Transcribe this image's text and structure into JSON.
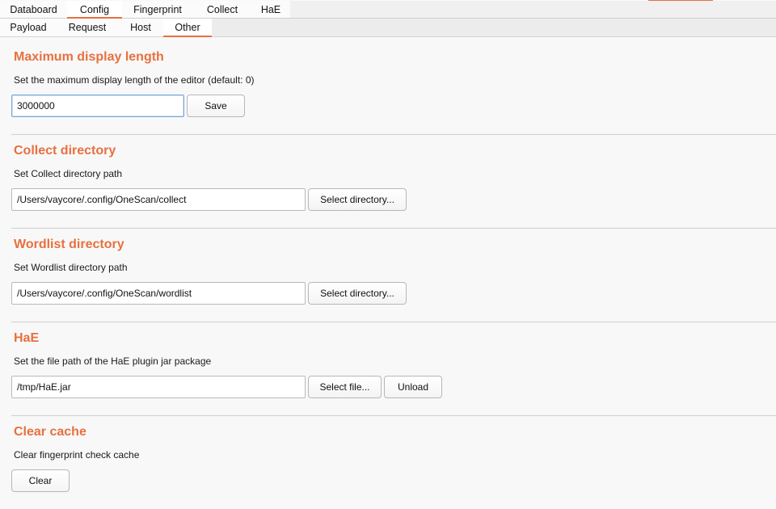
{
  "tabs_main": [
    {
      "label": "Databoard",
      "active": false
    },
    {
      "label": "Config",
      "active": true
    },
    {
      "label": "Fingerprint",
      "active": false
    },
    {
      "label": "Collect",
      "active": false
    },
    {
      "label": "HaE",
      "active": false
    }
  ],
  "tabs_config": [
    {
      "label": "Payload",
      "active": false
    },
    {
      "label": "Request",
      "active": false
    },
    {
      "label": "Host",
      "active": false
    },
    {
      "label": "Other",
      "active": true
    }
  ],
  "sections": {
    "max_display": {
      "title": "Maximum display length",
      "description": "Set the maximum display length of the editor (default: 0)",
      "value": "3000000",
      "save_label": "Save"
    },
    "collect_dir": {
      "title": "Collect directory",
      "description": "Set Collect directory path",
      "value": "/Users/vaycore/.config/OneScan/collect",
      "button_label": "Select directory..."
    },
    "wordlist_dir": {
      "title": "Wordlist directory",
      "description": "Set Wordlist directory path",
      "value": "/Users/vaycore/.config/OneScan/wordlist",
      "button_label": "Select directory..."
    },
    "hae": {
      "title": "HaE",
      "description": "Set the file path of the HaE plugin jar package",
      "value": "/tmp/HaE.jar",
      "select_label": "Select file...",
      "unload_label": "Unload"
    },
    "clear_cache": {
      "title": "Clear cache",
      "description": "Clear fingerprint check cache",
      "button_label": "Clear"
    }
  },
  "colors": {
    "accent": "#e8703f"
  }
}
